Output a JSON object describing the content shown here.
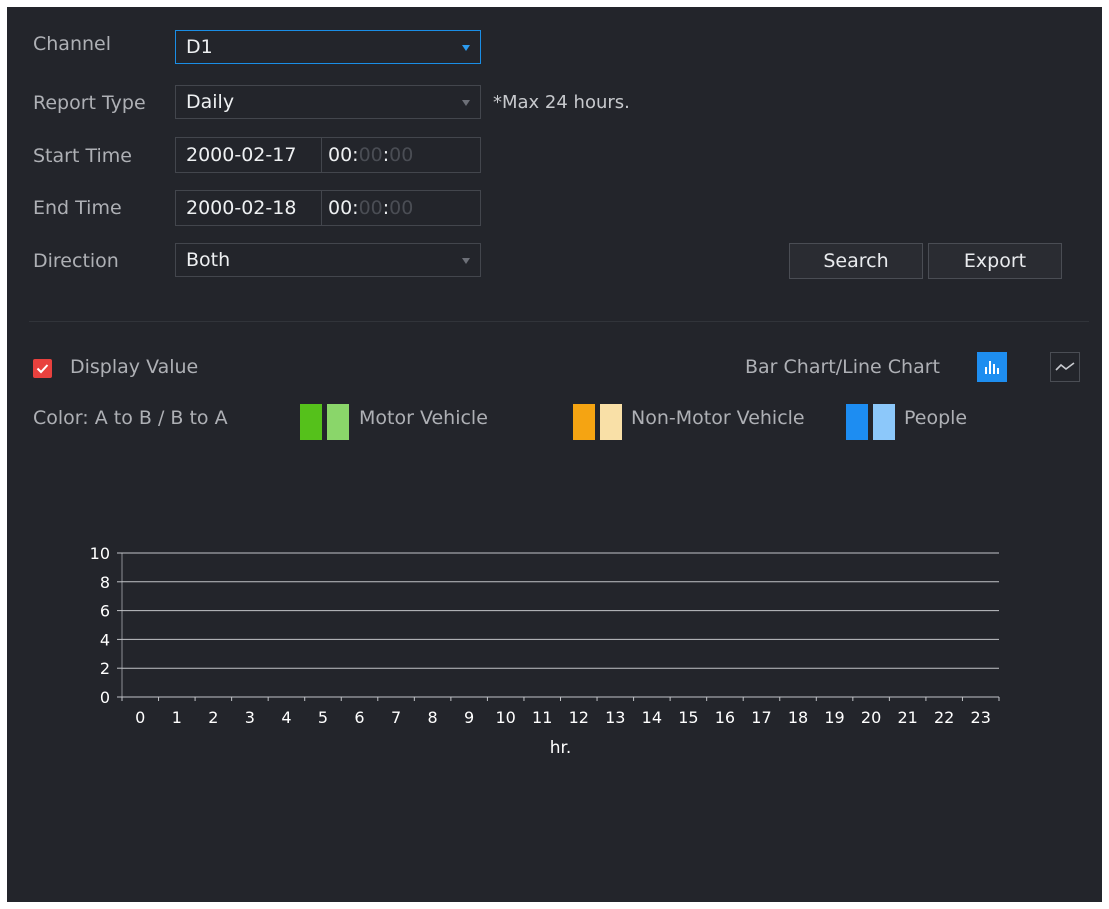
{
  "form": {
    "channel": {
      "label": "Channel",
      "value": "D1"
    },
    "report_type": {
      "label": "Report Type",
      "value": "Daily",
      "note": "*Max 24 hours."
    },
    "start_time": {
      "label": "Start Time",
      "date": "2000-02-17",
      "hh": "00:",
      "mm": "00",
      "sep": ":",
      "ss": "00"
    },
    "end_time": {
      "label": "End Time",
      "date": "2000-02-18",
      "hh": "00:",
      "mm": "00",
      "sep": ":",
      "ss": "00"
    },
    "direction": {
      "label": "Direction",
      "value": "Both"
    },
    "search_label": "Search",
    "export_label": "Export"
  },
  "display": {
    "display_value_label": "Display Value",
    "display_value_checked": true,
    "chart_toggle_label": "Bar Chart/Line Chart",
    "bar_chart_icon": "bar-chart-icon",
    "line_chart_icon": "line-chart-icon",
    "selected_mode": "bar"
  },
  "legend": {
    "title": "Color: A to B / B to A",
    "items": [
      {
        "name": "Motor Vehicle",
        "color_a_to_b": "#55c11b",
        "color_b_to_a": "#8ad66a"
      },
      {
        "name": "Non-Motor Vehicle",
        "color_a_to_b": "#f5a412",
        "color_b_to_a": "#f9e0a7"
      },
      {
        "name": "People",
        "color_a_to_b": "#1d8df2",
        "color_b_to_a": "#8cc8fa"
      }
    ]
  },
  "chart_data": {
    "type": "bar",
    "categories": [
      "0",
      "1",
      "2",
      "3",
      "4",
      "5",
      "6",
      "7",
      "8",
      "9",
      "10",
      "11",
      "12",
      "13",
      "14",
      "15",
      "16",
      "17",
      "18",
      "19",
      "20",
      "21",
      "22",
      "23"
    ],
    "series": [],
    "xlabel": "hr.",
    "ylabel": "",
    "ylim": [
      0,
      10
    ],
    "yticks": [
      0,
      2,
      4,
      6,
      8,
      10
    ],
    "grid": true
  }
}
